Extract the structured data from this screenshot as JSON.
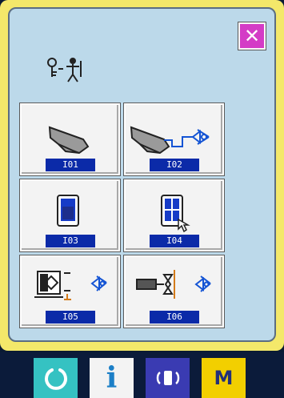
{
  "dialog": {
    "close_label": "✕",
    "title_icon": "maintenance-person-key-icon"
  },
  "tiles": [
    {
      "code": "I01",
      "icon": "presser-foot-icon"
    },
    {
      "code": "I02",
      "icon": "presser-foot-sensor-icon"
    },
    {
      "code": "I03",
      "icon": "bobbin-panel-icon"
    },
    {
      "code": "I04",
      "icon": "touch-panel-icon"
    },
    {
      "code": "I05",
      "icon": "display-sensor-icon"
    },
    {
      "code": "I06",
      "icon": "thread-trimmer-sensor-icon"
    }
  ],
  "bottom_bar": {
    "ready_icon": "ready-key-icon",
    "info_label": "i",
    "comm_icon": "communication-icon",
    "mode_label": "M"
  },
  "colors": {
    "frame": "#f4e86a",
    "panel": "#bcd9ea",
    "close": "#d43cc6",
    "code_bg": "#0b2aa8",
    "ready": "#35c2c2",
    "comm": "#3a3bb2",
    "mode": "#f2cf00"
  }
}
